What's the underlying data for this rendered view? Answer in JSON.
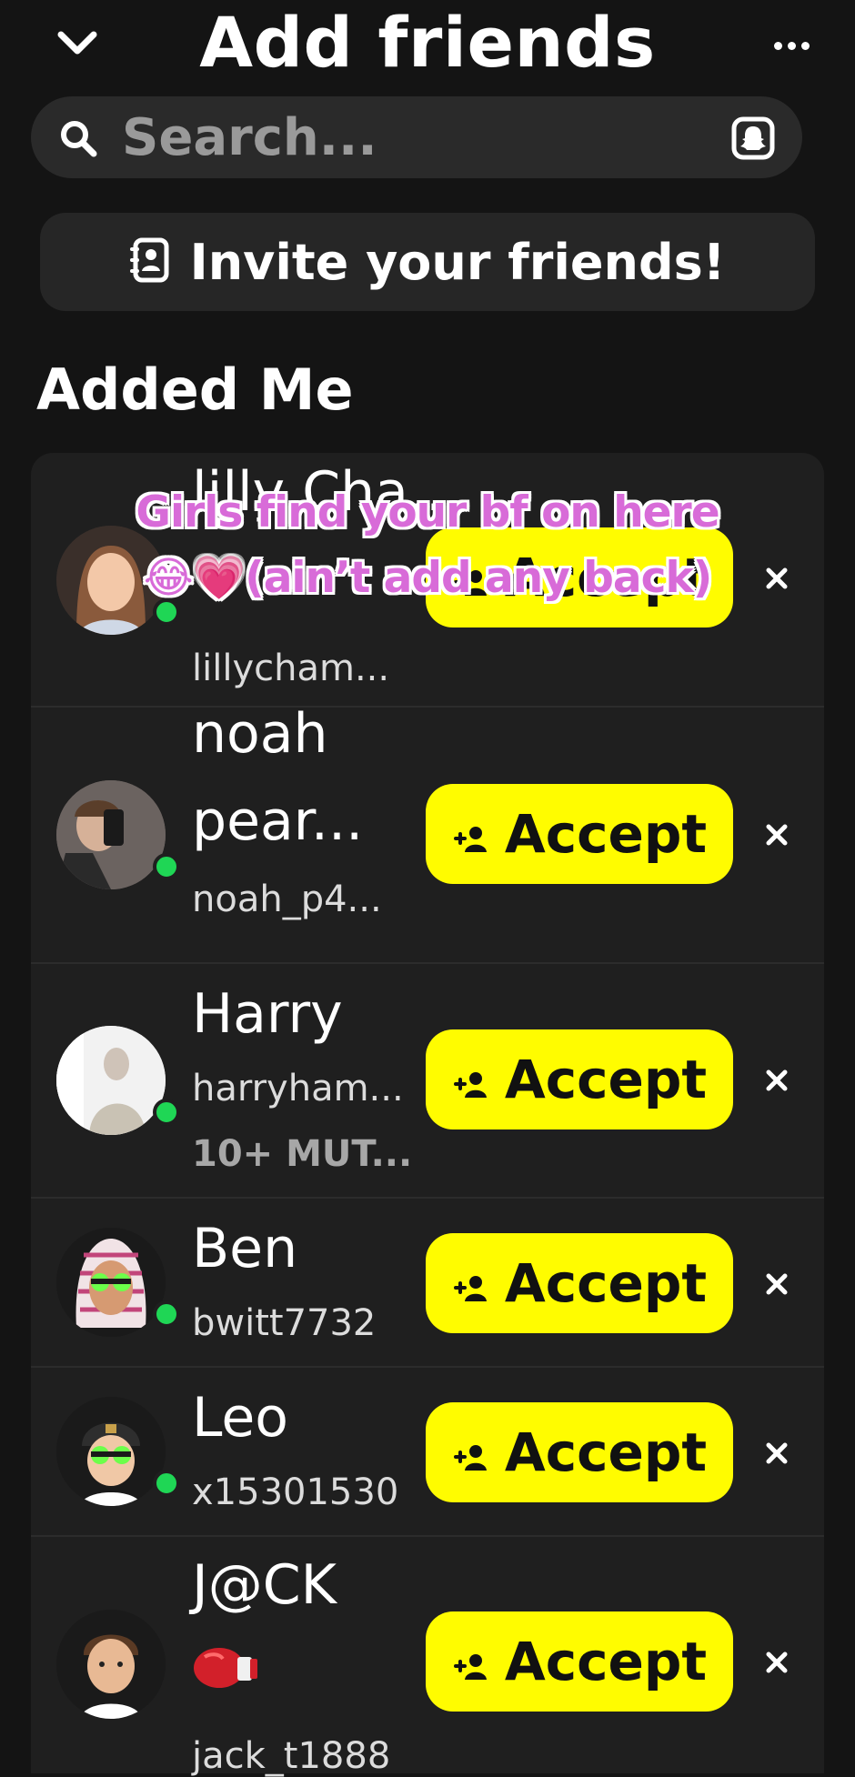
{
  "header": {
    "title": "Add friends"
  },
  "search": {
    "placeholder": "Search..."
  },
  "invite": {
    "label": "Invite your friends!"
  },
  "section": {
    "title": "Added Me"
  },
  "accept_label": "Accept",
  "requests": [
    {
      "name": "lilly Cha...",
      "username": "lillycham..."
    },
    {
      "name_line1": "noah",
      "name_line2": "pear...",
      "username": "noah_p4..."
    },
    {
      "name": "Harry",
      "username": "harryham...",
      "mutual": "10+ MUT..."
    },
    {
      "name": "Ben",
      "username": "bwitt7732"
    },
    {
      "name": "Leo",
      "username": "x15301530"
    },
    {
      "name": "J@CK",
      "username": "jack_t1888"
    }
  ],
  "overlay_caption": {
    "line1": "Girls find your bf on here",
    "line2": "😂💗(ain’t add any back)"
  },
  "colors": {
    "background": "#141414",
    "accent_yellow": "#fffc00",
    "online_green": "#1fd655",
    "caption_pink": "#d86bd8"
  }
}
